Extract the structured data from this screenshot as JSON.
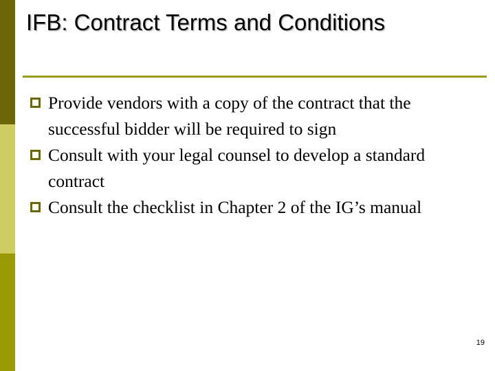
{
  "slide": {
    "title": "IFB: Contract Terms and Conditions",
    "page_number": "19",
    "bullets": [
      {
        "marker": "square-bullet-icon",
        "text": "Provide vendors with a copy of the contract that the successful bidder will be required to sign"
      },
      {
        "marker": "square-bullet-icon",
        "text": "Consult with your legal counsel to develop a standard contract"
      },
      {
        "marker": "square-bullet-icon",
        "text": "Consult the checklist in Chapter 2 of the IG’s manual"
      }
    ],
    "decoration": {
      "sidebar_colors": [
        "#6b6608",
        "#cdcd63",
        "#9a9a05"
      ],
      "rule_color": "#9a9a1f",
      "bullet_color": "#6b6608",
      "background_color": "#ffffff",
      "text_color": "#000000"
    }
  }
}
